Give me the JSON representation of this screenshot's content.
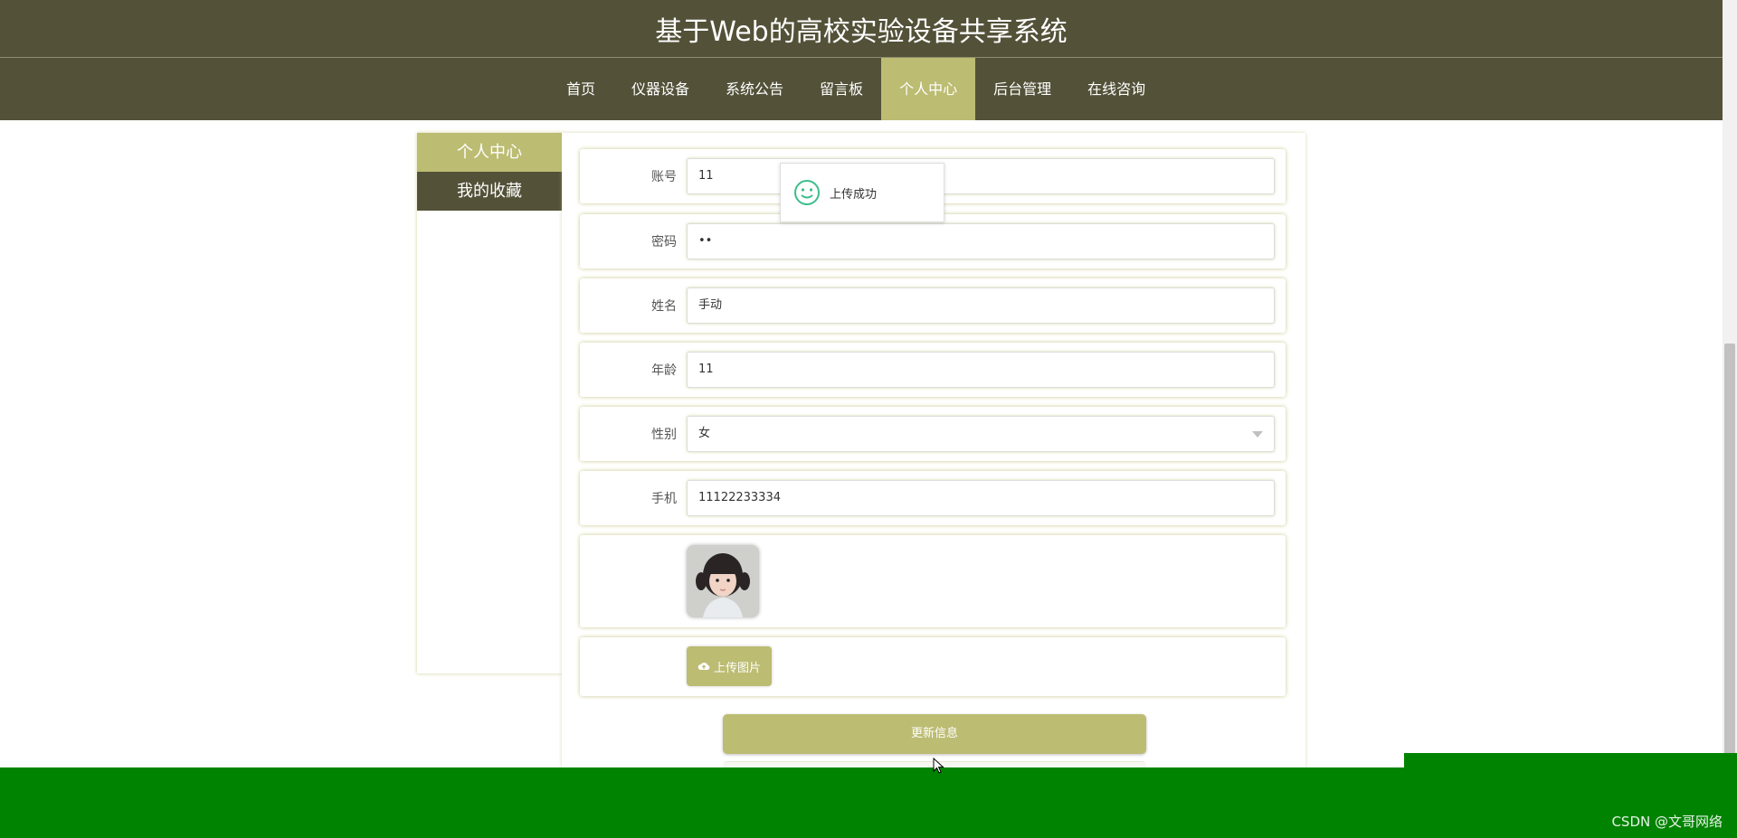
{
  "site": {
    "title": "基于Web的高校实验设备共享系统"
  },
  "nav": {
    "items": [
      {
        "label": "首页"
      },
      {
        "label": "仪器设备"
      },
      {
        "label": "系统公告"
      },
      {
        "label": "留言板"
      },
      {
        "label": "个人中心",
        "active": true
      },
      {
        "label": "后台管理"
      },
      {
        "label": "在线咨询"
      }
    ]
  },
  "sidebar": {
    "items": [
      {
        "label": "个人中心"
      },
      {
        "label": "我的收藏"
      }
    ]
  },
  "form": {
    "account": {
      "label": "账号",
      "value": "11"
    },
    "password": {
      "label": "密码",
      "value": "••"
    },
    "name": {
      "label": "姓名",
      "value": "手动"
    },
    "age": {
      "label": "年龄",
      "value": "11"
    },
    "gender": {
      "label": "性别",
      "value": "女"
    },
    "phone": {
      "label": "手机",
      "value": "11122233334"
    },
    "upload_label": "上传图片",
    "update_label": "更新信息"
  },
  "toast": {
    "message": "上传成功",
    "icon": "smile-icon"
  },
  "watermark": "CSDN @文哥网络",
  "colors": {
    "header": "#535138",
    "accent": "#bcbc73",
    "bottom_band": "#008300"
  }
}
